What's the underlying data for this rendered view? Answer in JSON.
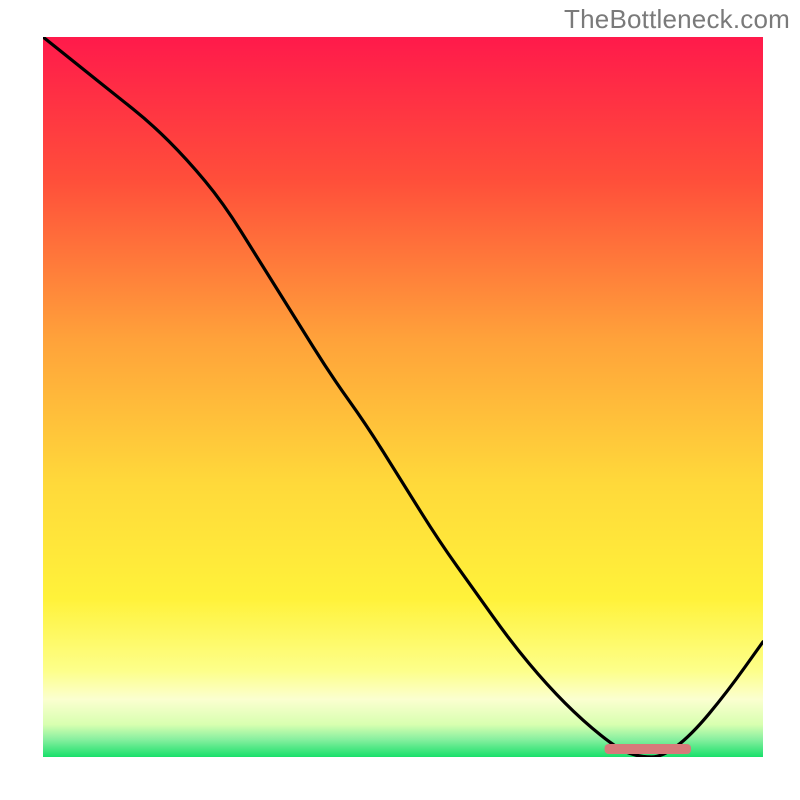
{
  "watermark": "TheBottleneck.com",
  "chart_data": {
    "type": "line",
    "title": "",
    "xlabel": "",
    "ylabel": "",
    "xlim": [
      0,
      100
    ],
    "ylim": [
      0,
      100
    ],
    "x": [
      0,
      5,
      10,
      15,
      20,
      25,
      30,
      35,
      40,
      45,
      50,
      55,
      60,
      65,
      70,
      75,
      80,
      83,
      86,
      90,
      95,
      100
    ],
    "values": [
      100,
      96,
      92,
      88,
      83,
      77,
      69,
      61,
      53,
      46,
      38,
      30,
      23,
      16,
      10,
      5,
      1,
      0,
      0,
      3,
      9,
      16
    ],
    "optimum_band": {
      "x_start": 78,
      "x_end": 90,
      "y": 0
    },
    "gradient_stops": [
      {
        "offset": 0.0,
        "color": "#ff1a4b"
      },
      {
        "offset": 0.2,
        "color": "#ff4f3a"
      },
      {
        "offset": 0.42,
        "color": "#ffa23a"
      },
      {
        "offset": 0.62,
        "color": "#ffd93a"
      },
      {
        "offset": 0.78,
        "color": "#fff23a"
      },
      {
        "offset": 0.88,
        "color": "#fdff8a"
      },
      {
        "offset": 0.92,
        "color": "#fbffd0"
      },
      {
        "offset": 0.955,
        "color": "#d8ffb0"
      },
      {
        "offset": 0.975,
        "color": "#8af0a0"
      },
      {
        "offset": 1.0,
        "color": "#18e06a"
      }
    ]
  }
}
